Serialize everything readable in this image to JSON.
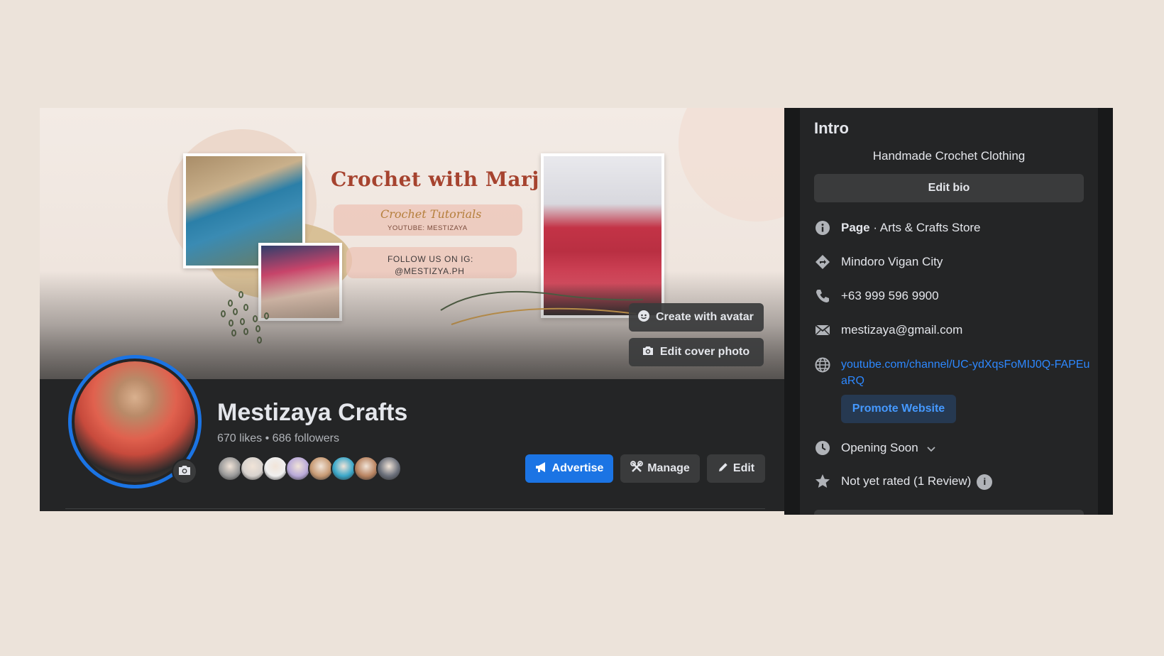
{
  "cover": {
    "title": "Crochet with Marj",
    "subtitle": "Crochet Tutorials",
    "youtube_line": "YOUTUBE: MESTIZAYA",
    "ig_line_1": "FOLLOW US ON IG:",
    "ig_line_2": "@MESTIZYA.PH",
    "create_avatar_label": "Create with avatar",
    "edit_cover_label": "Edit cover photo"
  },
  "profile": {
    "name": "Mestizaya Crafts",
    "likes": "670 likes",
    "separator": "•",
    "followers": "686 followers",
    "follower_faces": [
      "#9a9a9a",
      "#d8d3cf",
      "#f0f0f0",
      "#b9a9d9",
      "#c79a74",
      "#3aa7c9",
      "#b98461",
      "#6a6f7a"
    ]
  },
  "actions": {
    "advertise_label": "Advertise",
    "manage_label": "Manage",
    "edit_label": "Edit"
  },
  "intro": {
    "title": "Intro",
    "bio": "Handmade Crochet Clothing",
    "edit_bio_label": "Edit bio",
    "category_prefix": "Page",
    "category": " · Arts & Crafts Store",
    "location": "Mindoro Vigan City",
    "phone": "+63 999 596 9900",
    "email": "mestizaya@gmail.com",
    "website": "youtube.com/channel/UC-ydXqsFoMIJ0Q-FAPEuaRQ",
    "promote_label": "Promote Website",
    "hours": "Opening Soon",
    "rating": "Not yet rated (1 Review)",
    "info_badge": "i"
  },
  "colors": {
    "accent": "#1b74e4",
    "panel": "#242526",
    "link": "#2d88ff",
    "background": "#ece3da"
  },
  "icons": [
    "camera-icon",
    "avatar-icon",
    "megaphone-icon",
    "tools-icon",
    "pencil-icon",
    "info-icon",
    "directions-icon",
    "phone-icon",
    "mail-icon",
    "globe-icon",
    "clock-icon",
    "chevron-down-icon",
    "star-icon"
  ]
}
